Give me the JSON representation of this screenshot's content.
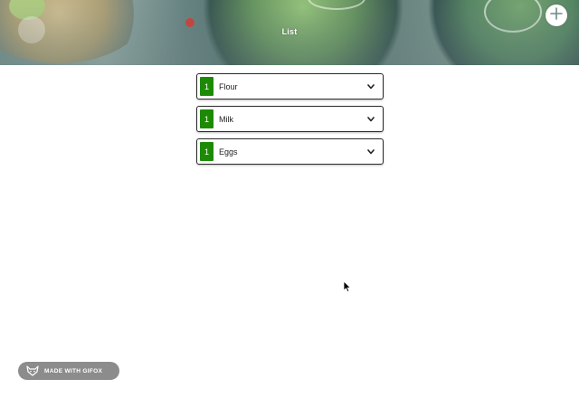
{
  "header": {
    "title": "List",
    "add_button_icon": "plus-icon"
  },
  "items": [
    {
      "quantity": "1",
      "label": "Flour",
      "icon": "chevron-down-icon"
    },
    {
      "quantity": "1",
      "label": "Milk",
      "icon": "chevron-down-icon"
    },
    {
      "quantity": "1",
      "label": "Eggs",
      "icon": "chevron-down-icon"
    }
  ],
  "badge": {
    "label": "MADE WITH GIFOX",
    "icon": "fox-icon"
  },
  "colors": {
    "quantity_badge": "#1c8a05",
    "item_border": "#2b2b2b",
    "header_text": "#ffffff",
    "badge_background": "#8c8c8c"
  }
}
